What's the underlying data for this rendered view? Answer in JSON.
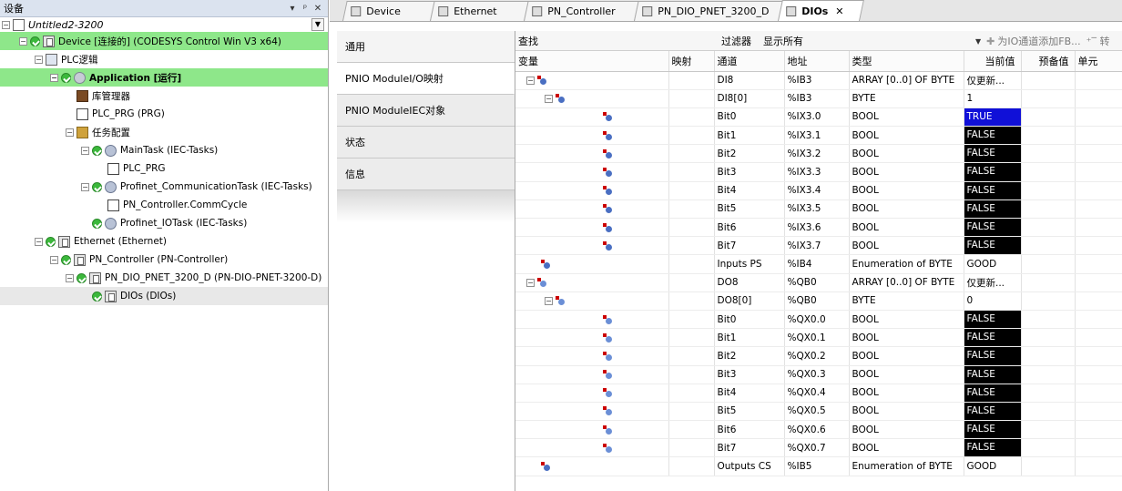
{
  "device_panel": {
    "title": "设备",
    "header_buttons": [
      "▾",
      "ᵖ",
      "✕"
    ],
    "root": "Untitled2-3200",
    "tree": [
      {
        "label": "Device [连接的] (CODESYS Control Win V3 x64)",
        "indent": 1
      },
      {
        "label": "PLC逻辑",
        "indent": 2
      },
      {
        "label": "Application [运行]",
        "indent": 3
      },
      {
        "label": "库管理器",
        "indent": 4
      },
      {
        "label": "PLC_PRG (PRG)",
        "indent": 4
      },
      {
        "label": "任务配置",
        "indent": 4
      },
      {
        "label": "MainTask (IEC-Tasks)",
        "indent": 5
      },
      {
        "label": "PLC_PRG",
        "indent": 6
      },
      {
        "label": "Profinet_CommunicationTask (IEC-Tasks)",
        "indent": 5
      },
      {
        "label": "PN_Controller.CommCycle",
        "indent": 6
      },
      {
        "label": "Profinet_IOTask (IEC-Tasks)",
        "indent": 5
      },
      {
        "label": "Ethernet (Ethernet)",
        "indent": 2
      },
      {
        "label": "PN_Controller (PN-Controller)",
        "indent": 3
      },
      {
        "label": "PN_DIO_PNET_3200_D (PN-DIO-PNET-3200-D)",
        "indent": 4
      },
      {
        "label": "DIOs (DIOs)",
        "indent": 5
      }
    ]
  },
  "editor_tabs": [
    "Device",
    "Ethernet",
    "PN_Controller",
    "PN_DIO_PNET_3200_D",
    "DIOs"
  ],
  "active_tab": "DIOs",
  "inner_tabs": [
    "通用",
    "PNIO ModuleI/O映射",
    "PNIO ModuleIEC对象",
    "状态",
    "信息"
  ],
  "toolbar": {
    "find_label": "查找",
    "filter_label": "过滤器",
    "filter_value": "显示所有",
    "add_fb_label": "为IO通道添加FB...",
    "extra": "⁺‾ 转"
  },
  "columns": [
    "变量",
    "映射",
    "通道",
    "地址",
    "类型",
    "当前值",
    "预备值",
    "单元"
  ],
  "rows": [
    {
      "channel": "DI8",
      "address": "%IB3",
      "type": "ARRAY [0..0] OF BYTE",
      "value": "仅更新...",
      "level": 0,
      "expander": "⊟",
      "dir": "in"
    },
    {
      "channel": "DI8[0]",
      "address": "%IB3",
      "type": "BYTE",
      "value": "1",
      "level": 1,
      "expander": "⊟",
      "dir": "in"
    },
    {
      "channel": "Bit0",
      "address": "%IX3.0",
      "type": "BOOL",
      "value": "TRUE",
      "level": 2,
      "dir": "in",
      "style": "true"
    },
    {
      "channel": "Bit1",
      "address": "%IX3.1",
      "type": "BOOL",
      "value": "FALSE",
      "level": 2,
      "dir": "in",
      "style": "false"
    },
    {
      "channel": "Bit2",
      "address": "%IX3.2",
      "type": "BOOL",
      "value": "FALSE",
      "level": 2,
      "dir": "in",
      "style": "false"
    },
    {
      "channel": "Bit3",
      "address": "%IX3.3",
      "type": "BOOL",
      "value": "FALSE",
      "level": 2,
      "dir": "in",
      "style": "false"
    },
    {
      "channel": "Bit4",
      "address": "%IX3.4",
      "type": "BOOL",
      "value": "FALSE",
      "level": 2,
      "dir": "in",
      "style": "false"
    },
    {
      "channel": "Bit5",
      "address": "%IX3.5",
      "type": "BOOL",
      "value": "FALSE",
      "level": 2,
      "dir": "in",
      "style": "false"
    },
    {
      "channel": "Bit6",
      "address": "%IX3.6",
      "type": "BOOL",
      "value": "FALSE",
      "level": 2,
      "dir": "in",
      "style": "false"
    },
    {
      "channel": "Bit7",
      "address": "%IX3.7",
      "type": "BOOL",
      "value": "FALSE",
      "level": 2,
      "dir": "in",
      "style": "false"
    },
    {
      "channel": "Inputs PS",
      "address": "%IB4",
      "type": "Enumeration of BYTE",
      "value": "GOOD",
      "level": 0,
      "dir": "in"
    },
    {
      "channel": "DO8",
      "address": "%QB0",
      "type": "ARRAY [0..0] OF BYTE",
      "value": "仅更新...",
      "level": 0,
      "expander": "⊟",
      "dir": "out"
    },
    {
      "channel": "DO8[0]",
      "address": "%QB0",
      "type": "BYTE",
      "value": "0",
      "level": 1,
      "expander": "⊟",
      "dir": "out"
    },
    {
      "channel": "Bit0",
      "address": "%QX0.0",
      "type": "BOOL",
      "value": "FALSE",
      "level": 2,
      "dir": "out",
      "style": "false"
    },
    {
      "channel": "Bit1",
      "address": "%QX0.1",
      "type": "BOOL",
      "value": "FALSE",
      "level": 2,
      "dir": "out",
      "style": "false"
    },
    {
      "channel": "Bit2",
      "address": "%QX0.2",
      "type": "BOOL",
      "value": "FALSE",
      "level": 2,
      "dir": "out",
      "style": "false"
    },
    {
      "channel": "Bit3",
      "address": "%QX0.3",
      "type": "BOOL",
      "value": "FALSE",
      "level": 2,
      "dir": "out",
      "style": "false"
    },
    {
      "channel": "Bit4",
      "address": "%QX0.4",
      "type": "BOOL",
      "value": "FALSE",
      "level": 2,
      "dir": "out",
      "style": "false"
    },
    {
      "channel": "Bit5",
      "address": "%QX0.5",
      "type": "BOOL",
      "value": "FALSE",
      "level": 2,
      "dir": "out",
      "style": "false"
    },
    {
      "channel": "Bit6",
      "address": "%QX0.6",
      "type": "BOOL",
      "value": "FALSE",
      "level": 2,
      "dir": "out",
      "style": "false"
    },
    {
      "channel": "Bit7",
      "address": "%QX0.7",
      "type": "BOOL",
      "value": "FALSE",
      "level": 2,
      "dir": "out",
      "style": "false"
    },
    {
      "channel": "Outputs CS",
      "address": "%IB5",
      "type": "Enumeration of BYTE",
      "value": "GOOD",
      "level": 0,
      "dir": "in"
    }
  ],
  "colors": {
    "online_green": "#8ee78a",
    "true_bg": "#1010d8",
    "false_bg": "#000000"
  }
}
